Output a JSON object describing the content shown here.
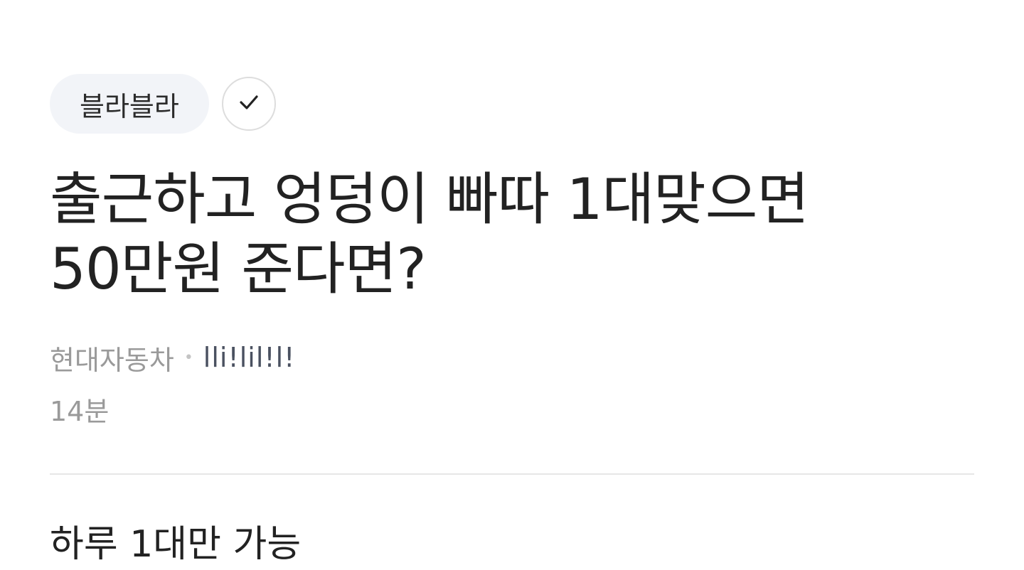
{
  "topic": {
    "label": "블라블라",
    "check_icon": "checkmark-icon"
  },
  "post": {
    "title": "출근하고 엉덩이 빠따 1대맞으면 50만원 준다면?",
    "company": "현대자동차",
    "separator": "•",
    "author": "lli!lil!l!",
    "time": "14분",
    "body": "하루 1대만 가능"
  },
  "colors": {
    "chip_background": "#f2f4f8",
    "title_text": "#222222",
    "meta_text": "#9a9a9a",
    "author_text": "#4a5160",
    "divider": "#e6e6e6"
  }
}
